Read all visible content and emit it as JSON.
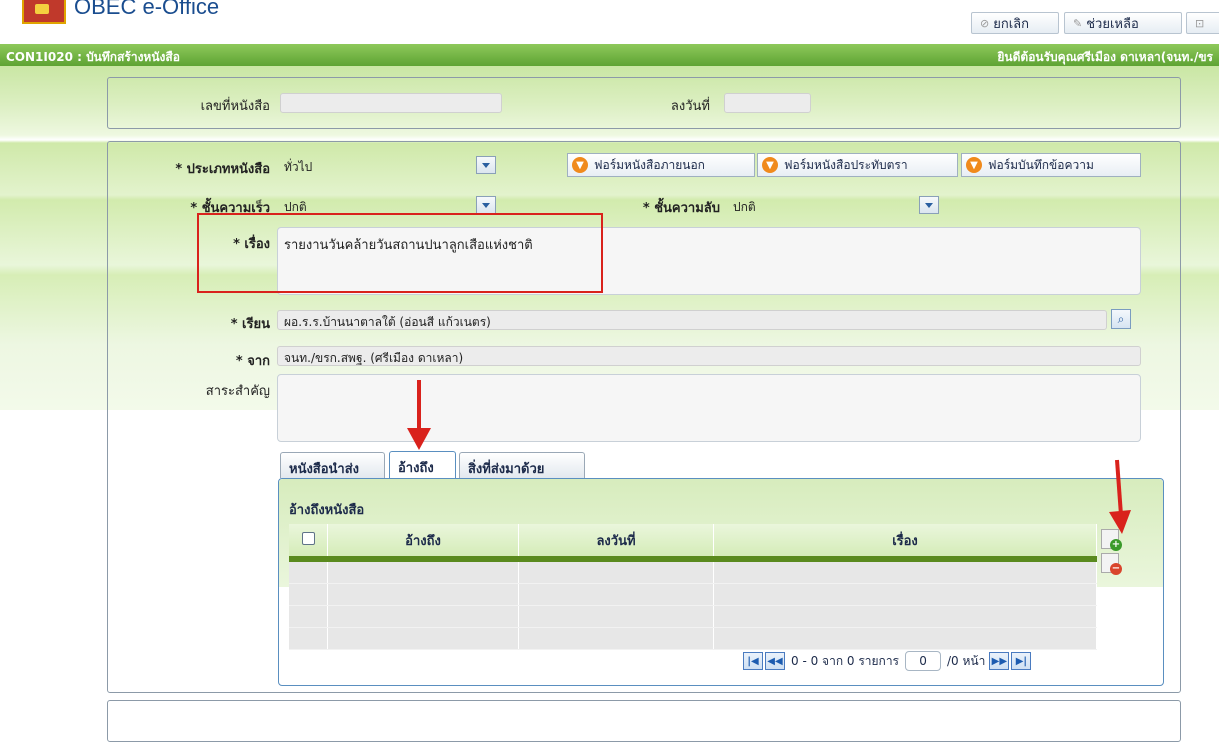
{
  "app": {
    "title": "OBEC e-Office"
  },
  "toolbar": {
    "cancel_label": "ยกเลิก",
    "help_label": "ช่วยเหลือ"
  },
  "header": {
    "code": "CON1I020 : บันทึกสร้างหนังสือ",
    "welcome": "ยินดีต้อนรับคุณศรีเมือง ดาเหลา(จนท./ขร"
  },
  "top_panel": {
    "doc_number_label": "เลขที่หนังสือ",
    "doc_number_value": "",
    "date_label": "ลงวันที่",
    "date_value": ""
  },
  "form": {
    "doc_type_label": "* ประเภทหนังสือ",
    "doc_type_value": "ทั่วไป",
    "btn_external": "ฟอร์มหนังสือภายนอก",
    "btn_seal": "ฟอร์มหนังสือประทับตรา",
    "btn_memo": "ฟอร์มบันทึกข้อความ",
    "urgency_label": "* ชั้นความเร็ว",
    "urgency_value": "ปกติ",
    "secrecy_label": "* ชั้นความลับ",
    "secrecy_value": "ปกติ",
    "subject_label": "* เรื่อง",
    "subject_value": "รายงานวันคล้ายวันสถานปนาลูกเสือแห่งชาติ",
    "to_label": "* เรียน",
    "to_value": "ผอ.ร.ร.บ้านนาตาลใต้ (อ่อนสี แก้วเนตร)",
    "from_label": "* จาก",
    "from_value": "จนท./ขรก.สพฐ. (ศรีเมือง ดาเหลา)",
    "summary_label": "สาระสำคัญ",
    "summary_value": ""
  },
  "tabs": [
    {
      "label": "หนังสือนำส่ง"
    },
    {
      "label": "อ้างถึง"
    },
    {
      "label": "สิ่งที่ส่งมาด้วย"
    }
  ],
  "reference": {
    "title": "อ้างถึงหนังสือ",
    "columns": [
      "อ้างถึง",
      "ลงวันที่",
      "เรื่อง"
    ],
    "pager": {
      "summary": "0 - 0 จาก 0 รายการ",
      "page": "0",
      "of_pages": "/0 หน้า"
    }
  },
  "colors": {
    "header_green": "#5ea333",
    "annotation_red": "#d9221c",
    "button_orange": "#f08a1c"
  },
  "icons": [
    "cancel-icon",
    "wrench-icon",
    "dropdown-arrow-icon",
    "download-circle-icon",
    "search-icon",
    "add-row-icon",
    "remove-row-icon",
    "first-page-icon",
    "prev-page-icon",
    "next-page-icon",
    "last-page-icon"
  ]
}
